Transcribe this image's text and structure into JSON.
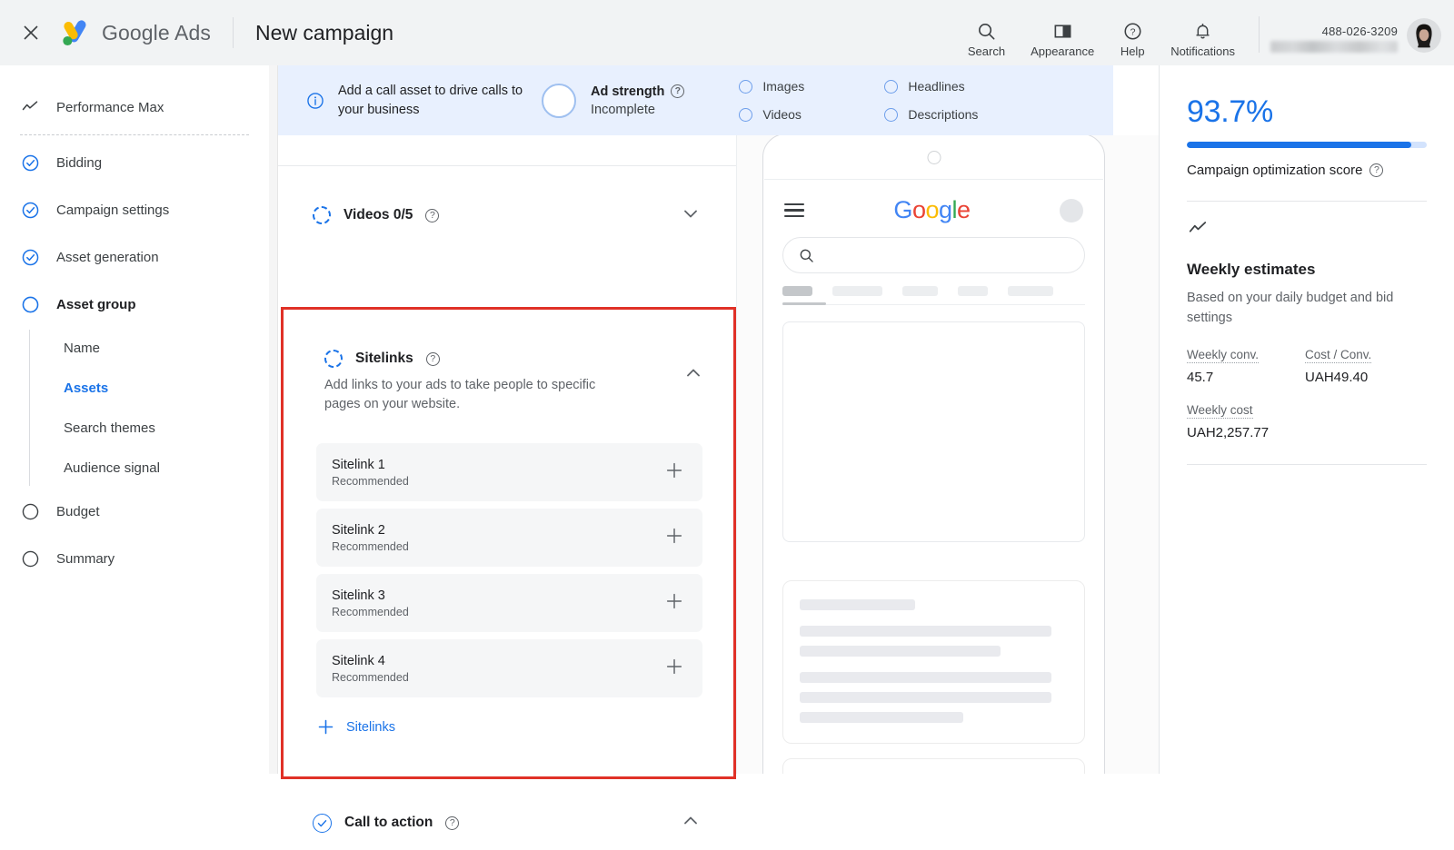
{
  "topbar": {
    "close_icon": "close-icon",
    "brand": "Google Ads",
    "brand_google": "Google",
    "brand_ads": "Ads",
    "page_title": "New campaign",
    "items": [
      {
        "label": "Search",
        "icon": "search-icon"
      },
      {
        "label": "Appearance",
        "icon": "appearance-icon"
      },
      {
        "label": "Help",
        "icon": "help-icon"
      },
      {
        "label": "Notifications",
        "icon": "bell-icon"
      }
    ],
    "account_number": "488-026-3209"
  },
  "sidebar": {
    "items": [
      {
        "label": "Performance Max",
        "icon": "trend-icon",
        "state": "header"
      },
      {
        "label": "Bidding",
        "icon": "check-circle-icon",
        "state": "complete"
      },
      {
        "label": "Campaign settings",
        "icon": "check-circle-icon",
        "state": "complete"
      },
      {
        "label": "Asset generation",
        "icon": "check-circle-icon",
        "state": "complete"
      },
      {
        "label": "Asset group",
        "icon": "circle-icon",
        "state": "current"
      },
      {
        "label": "Budget",
        "icon": "circle-icon",
        "state": "pending"
      },
      {
        "label": "Summary",
        "icon": "circle-icon",
        "state": "pending"
      }
    ],
    "sub_items": [
      {
        "label": "Name",
        "active": false
      },
      {
        "label": "Assets",
        "active": true
      },
      {
        "label": "Search themes",
        "active": false
      },
      {
        "label": "Audience signal",
        "active": false
      }
    ]
  },
  "banner": {
    "info_icon": "info-icon",
    "message": "Add a call asset to drive calls to your business",
    "ad_strength_label": "Ad strength",
    "ad_strength_value": "Incomplete",
    "checks": [
      "Images",
      "Headlines",
      "Videos",
      "Descriptions"
    ]
  },
  "content": {
    "videos": {
      "title": "Videos 0/5",
      "chevron": "chevron-down-icon"
    },
    "sitelinks": {
      "title": "Sitelinks",
      "description": "Add links to your ads to take people to specific pages on your website.",
      "chevron": "chevron-up-icon",
      "rows": [
        {
          "name": "Sitelink 1",
          "status": "Recommended"
        },
        {
          "name": "Sitelink 2",
          "status": "Recommended"
        },
        {
          "name": "Sitelink 3",
          "status": "Recommended"
        },
        {
          "name": "Sitelink 4",
          "status": "Recommended"
        }
      ],
      "add_label": "Sitelinks"
    },
    "call_to_action": {
      "title": "Call to action",
      "chevron": "chevron-up-icon"
    }
  },
  "preview": {
    "google_logo_letters": [
      "G",
      "o",
      "o",
      "g",
      "l",
      "e"
    ],
    "search_icon": "search-icon",
    "menu_icon": "hamburger-icon"
  },
  "right_panel": {
    "score": "93.7%",
    "score_percent": 93.7,
    "score_label": "Campaign optimization score",
    "trend_icon": "trend-icon",
    "estimates_title": "Weekly estimates",
    "estimates_subtitle": "Based on your daily budget and bid settings",
    "metrics": [
      {
        "key": "Weekly conv.",
        "value": "45.7"
      },
      {
        "key": "Cost / Conv.",
        "value": "UAH49.40"
      },
      {
        "key": "Weekly cost",
        "value": "UAH2,257.77"
      }
    ]
  },
  "colors": {
    "accent_blue": "#1a73e8",
    "banner_bg": "#e8f0fe",
    "highlight_red": "#e03127",
    "row_bg": "#f5f6f7"
  }
}
